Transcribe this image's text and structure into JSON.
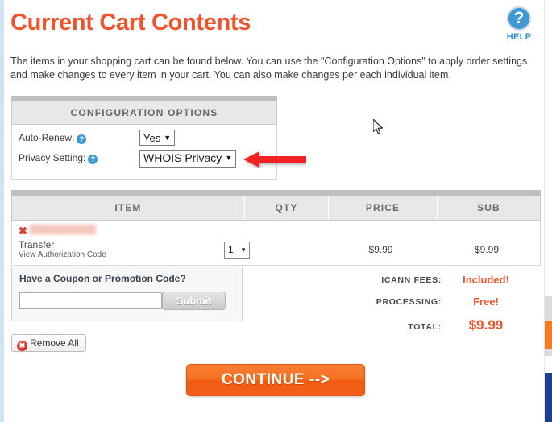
{
  "page": {
    "title": "Current Cart Contents",
    "intro": "The items in your shopping cart can be found below. You can use the \"Configuration Options\" to apply order settings and make changes to every item in your cart. You can also make changes per each individual item.",
    "accent_color": "#f0542d",
    "link_color": "#2f8fd0"
  },
  "help": {
    "icon": "question-circle-icon",
    "glyph": "?",
    "label": "HELP"
  },
  "config_panel": {
    "header": "CONFIGURATION OPTIONS",
    "rows": [
      {
        "label": "Auto-Renew:",
        "help_glyph": "?",
        "value": "Yes",
        "arrow": "▼"
      },
      {
        "label": "Privacy Setting:",
        "help_glyph": "?",
        "value": "WHOIS Privacy",
        "arrow": "▼"
      }
    ]
  },
  "annotation": {
    "arrow": "left-pointing-red-arrow",
    "color": "#f32020"
  },
  "cart": {
    "columns": [
      "ITEM",
      "QTY",
      "PRICE",
      "SUB"
    ],
    "rows": [
      {
        "remove_glyph": "✖",
        "domain_redacted": "",
        "type": "Transfer",
        "auth_link": "View Authorization Code",
        "qty": "1",
        "qty_arrow": "▼",
        "price": "$9.99",
        "sub": "$9.99"
      }
    ]
  },
  "coupon": {
    "title": "Have a Coupon or Promotion Code?",
    "input_value": "",
    "input_placeholder": "",
    "submit_label": "Submit"
  },
  "remove_all": {
    "glyph": "✖",
    "label": "Remove All"
  },
  "totals": [
    {
      "label": "ICANN FEES:",
      "value": "Included!"
    },
    {
      "label": "PROCESSING:",
      "value": "Free!"
    },
    {
      "label": "TOTAL:",
      "value": "$9.99"
    }
  ],
  "continue": {
    "label": "CONTINUE -->"
  },
  "chrome": {
    "scrollbar_orange": "#f47b20",
    "scrollbar_track": "#dcdcdc",
    "bottom_bar": "#1c3f8f"
  }
}
